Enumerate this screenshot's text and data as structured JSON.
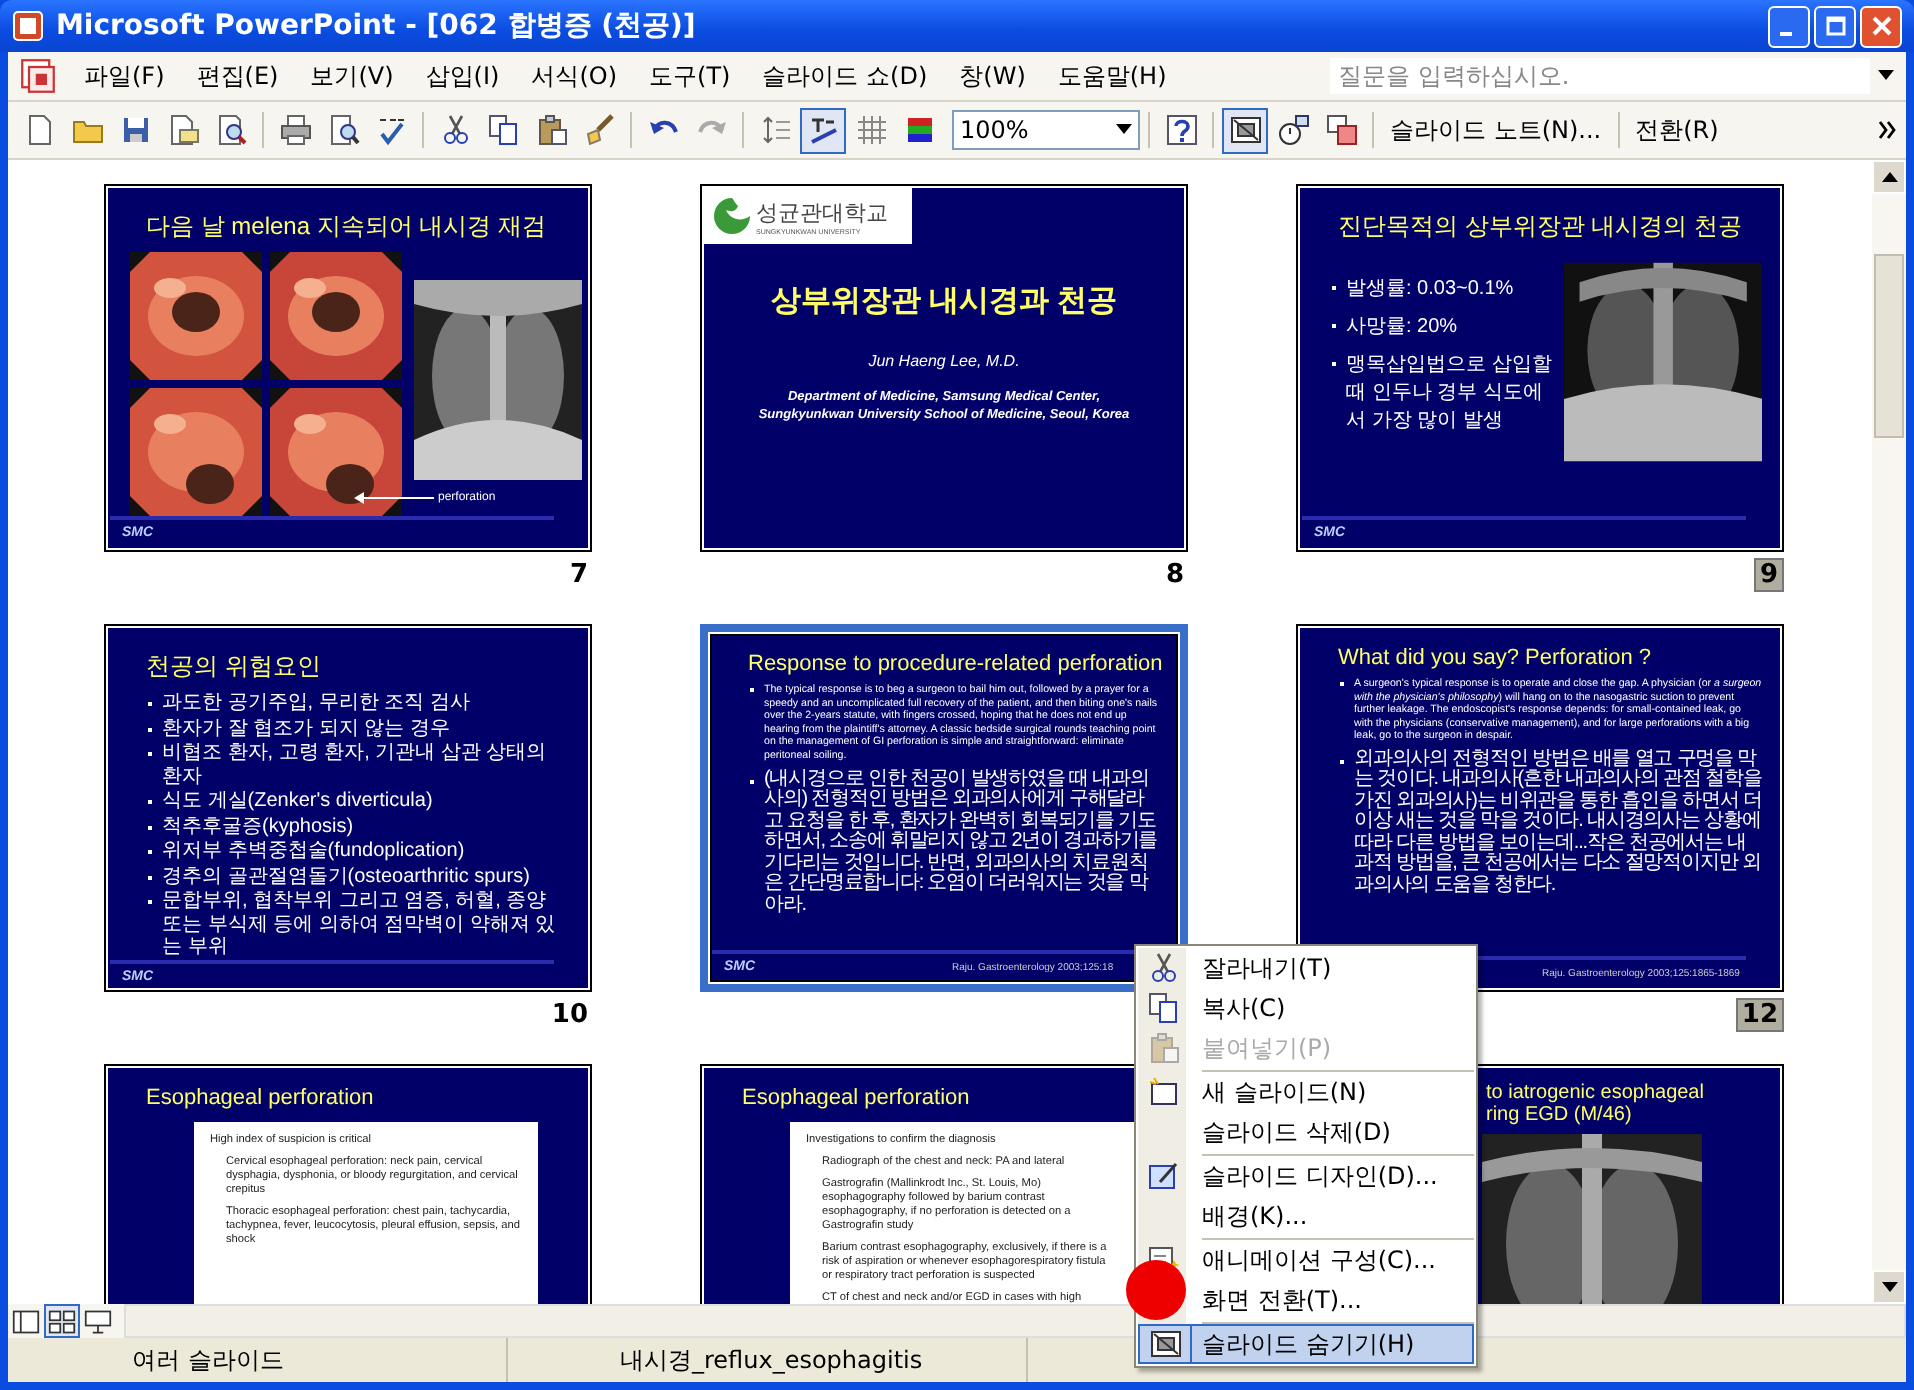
{
  "window": {
    "title": "Microsoft PowerPoint - [062 합병증 (천공)]"
  },
  "menu": [
    "파일(F)",
    "편집(E)",
    "보기(V)",
    "삽입(I)",
    "서식(O)",
    "도구(T)",
    "슬라이드 쇼(D)",
    "창(W)",
    "도움말(H)"
  ],
  "help_box": {
    "placeholder": "질문을 입력하십시오."
  },
  "toolbar": {
    "buttons": [
      {
        "kind": "new",
        "pressed": false
      },
      {
        "kind": "open",
        "pressed": false
      },
      {
        "kind": "save",
        "pressed": false
      },
      {
        "kind": "mail",
        "pressed": false
      },
      {
        "kind": "search",
        "pressed": false
      },
      {
        "kind": "print",
        "pressed": false
      },
      {
        "kind": "preview",
        "pressed": false
      },
      {
        "kind": "spell",
        "pressed": false
      },
      {
        "kind": "cut",
        "pressed": false
      },
      {
        "kind": "copy",
        "pressed": false
      },
      {
        "kind": "paste",
        "pressed": false
      },
      {
        "kind": "brush",
        "pressed": false
      },
      {
        "kind": "undo",
        "pressed": false
      },
      {
        "kind": "redo",
        "pressed": false
      },
      {
        "kind": "expand",
        "pressed": false
      },
      {
        "kind": "formatting",
        "pressed": true
      },
      {
        "kind": "grid",
        "pressed": false
      },
      {
        "kind": "color",
        "pressed": false
      }
    ],
    "zoom": "100%",
    "buttons_after": [
      {
        "kind": "help",
        "pressed": false
      },
      {
        "kind": "hide",
        "pressed": true
      },
      {
        "kind": "timings",
        "pressed": false
      },
      {
        "kind": "summary",
        "pressed": false
      }
    ],
    "notes_button": "슬라이드 노트(N)...",
    "transition_button": "전환(R)"
  },
  "slides": [
    {
      "number": "7",
      "hidden": false,
      "selected": false,
      "kind": "endoscopy",
      "title": "다음 날 melena 지속되어 내시경 재검",
      "caption": "perforation",
      "footer": "SMC"
    },
    {
      "number": "8",
      "hidden": false,
      "selected": false,
      "kind": "cover",
      "logo_name": "성균관대학교",
      "logo_sub": "SUNGKYUNKWAN UNIVERSITY",
      "title": "상부위장관 내시경과 천공",
      "author": "Jun Haeng Lee, M.D.",
      "affiliation": [
        "Department of Medicine, Samsung Medical Center,",
        "Sungkyunkwan University School of Medicine, Seoul, Korea"
      ]
    },
    {
      "number": "9",
      "hidden": true,
      "selected": false,
      "kind": "bullets-xray",
      "title": "진단목적의 상부위장관 내시경의 천공",
      "bullets": [
        "발생률: 0.03~0.1%",
        "사망률: 20%",
        "맹목삽입법으로 삽입할 때 인두나 경부 식도에서 가장 많이 발생"
      ],
      "footer": "SMC"
    },
    {
      "number": "10",
      "hidden": false,
      "selected": false,
      "kind": "bullets",
      "title": "천공의 위험요인",
      "bullets": [
        "과도한 공기주입, 무리한 조직 검사",
        "환자가 잘 협조가 되지 않는 경우",
        "비협조 환자, 고령 환자, 기관내 삽관 상태의 환자",
        "식도 게실(Zenker's diverticula)",
        "척추후굴증(kyphosis)",
        "위저부 추벽중첩술(fundoplication)",
        "경추의 골관절염돌기(osteoarthritic spurs)",
        "문합부위, 협착부위 그리고 염증, 허혈, 종양 또는 부식제 등에 의하여 점막벽이 약해져 있는 부위"
      ],
      "footer": "SMC"
    },
    {
      "selected": true,
      "kind": "paragraphs",
      "title": "Response to procedure-related perforation",
      "bullets": [
        "The typical response is to beg a surgeon to bail him out, followed by a prayer for a speedy and an uncomplicated full recovery of the patient, and then biting one's nails over the 2-years statute, with fingers crossed, hoping that he does not end up hearing from the plaintiff's attorney. A classic bedside surgical rounds teaching point on the management of GI perforation is simple and straightforward: eliminate peritoneal soiling.",
        "(내시경으로 인한 천공이 발생하였을 때 내과의사의) 전형적인 방법은 외과의사에게 구해달라고 요청을 한 후, 환자가 완벽히 회복되기를 기도하면서, 소송에 휘말리지 않고 2년이 경과하기를 기다리는 것입니다. 반면, 외과의사의 치료원칙은 간단명료합니다: 오염이 더러워지는 것을 막아라."
      ],
      "source": "Raju. Gastroenterology 2003;125:18",
      "footer": "SMC"
    },
    {
      "number": "12",
      "hidden": true,
      "selected": false,
      "kind": "paragraphs",
      "title": "What did you say? Perforation ?",
      "bullets": [
        "A surgeon's typical response is to operate and close the gap. A physician (or *a surgeon with the physician's philosophy*) will hang on to the nasogastric suction to prevent further leakage. The endoscopist's response depends: for small-contained leak, go with the physicians (conservative management), and for large perforations with a big leak, go to the surgeon in despair.",
        "외과의사의 전형적인 방법은 배를 열고 구멍을 막는 것이다. 내과의사(흔한 내과의사의 관점 철학을 가진 외과의사)는 비위관을 통한 흡인을 하면서 더 이상 새는 것을 막을 것이다. 내시경의사는 상황에 따라 다른 방법을 보이는데...작은 천공에서는 내과적 방법을, 큰 천공에서는 다소 절망적이지만 외과의사의 도움을 청한다."
      ],
      "source": "Raju. Gastroenterology 2003;125:1865-1869"
    },
    {
      "selected": false,
      "kind": "boxed",
      "title": "Esophageal perforation",
      "box_items": [
        "High index of suspicion is critical",
        "Cervical esophageal perforation: neck pain, cervical dysphagia, dysphonia, or bloody regurgitation, and cervical crepitus",
        "Thoracic esophageal perforation: chest pain, tachycardia, tachypnea, fever, leucocytosis, pleural effusion, sepsis, and shock"
      ]
    },
    {
      "selected": false,
      "kind": "boxed",
      "title": "Esophageal perforation",
      "box_items": [
        "Investigations to confirm the diagnosis",
        "Radiograph of the chest and neck: PA and lateral",
        "Gastrografin (Mallinkrodt Inc., St. Louis, Mo) esophagography followed by barium contrast esophagography, if no perforation is detected on a Gastrografin study",
        "Barium contrast esophagography, exclusively, if there is a risk of aspiration or whenever esophagorespiratory fistula or respiratory tract perforation is suspected",
        "CT of chest and neck and/or EGD in cases with high"
      ]
    },
    {
      "selected": false,
      "kind": "xray-title",
      "title_lines": [
        "to iatrogenic esophageal",
        "ring EGD (M/46)"
      ]
    }
  ],
  "context_menu": [
    {
      "label": "잘라내기(T)",
      "disabled": false,
      "selected": false
    },
    {
      "label": "복사(C)",
      "disabled": false,
      "selected": false
    },
    {
      "label": "붙여넣기(P)",
      "disabled": true,
      "selected": false
    },
    {
      "label": "새 슬라이드(N)",
      "disabled": false,
      "selected": false
    },
    {
      "label": "슬라이드 삭제(D)",
      "disabled": false,
      "selected": false
    },
    {
      "label": "슬라이드 디자인(D)...",
      "disabled": false,
      "selected": false
    },
    {
      "label": "배경(K)...",
      "disabled": false,
      "selected": false
    },
    {
      "label": "애니메이션 구성(C)...",
      "disabled": false,
      "selected": false
    },
    {
      "label": "화면 전환(T)...",
      "disabled": false,
      "selected": false
    },
    {
      "label": "슬라이드 숨기기(H)",
      "disabled": false,
      "selected": true
    }
  ],
  "view_buttons": [
    {
      "kind": "normal",
      "selected": false
    },
    {
      "kind": "sorter",
      "selected": true
    },
    {
      "kind": "show",
      "selected": false
    }
  ],
  "status_bar": [
    "여러 슬라이드",
    "내시경_reflux_esophagitis"
  ]
}
